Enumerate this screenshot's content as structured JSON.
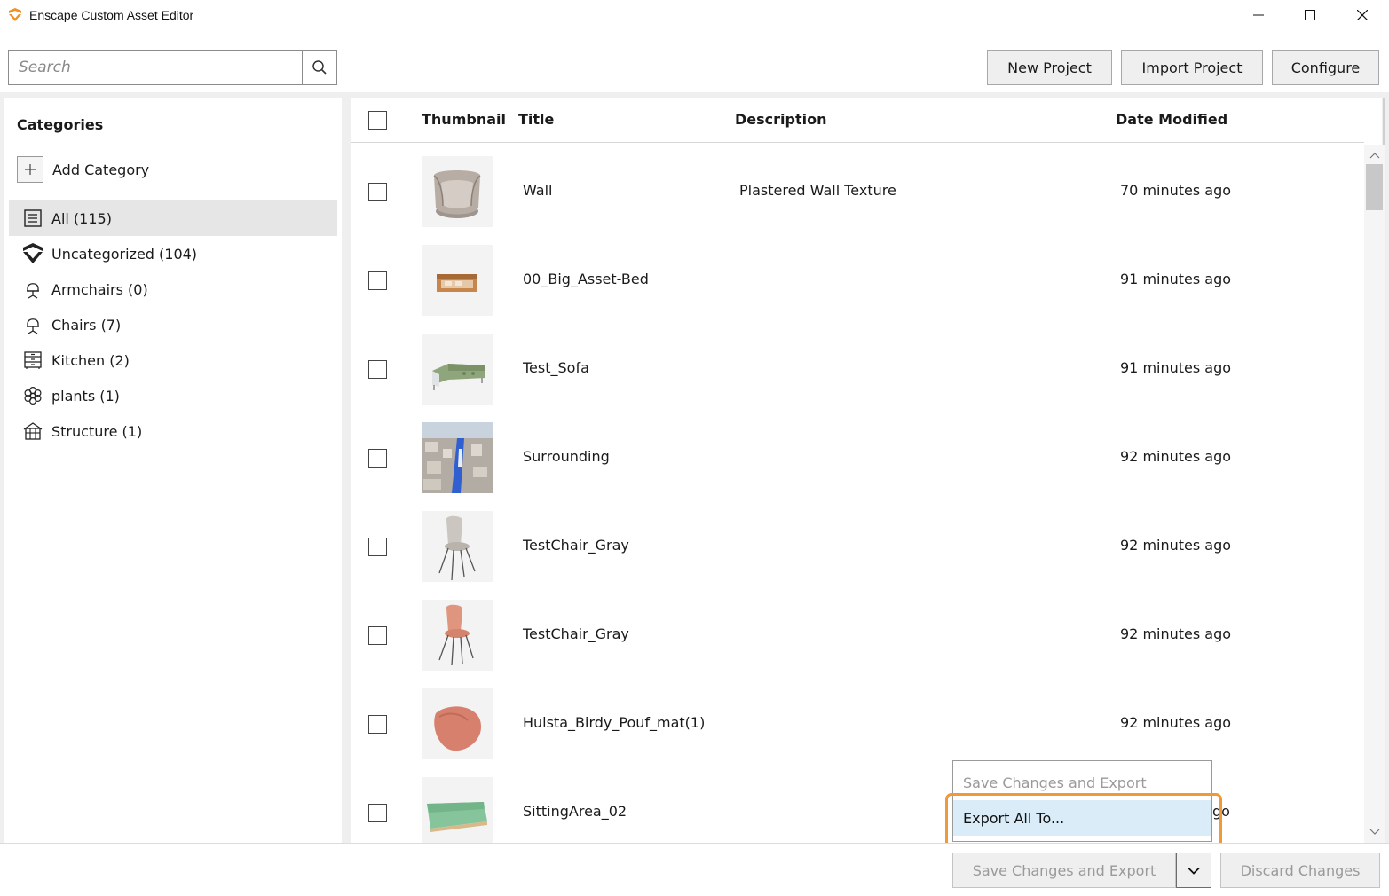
{
  "window": {
    "title": "Enscape Custom Asset Editor",
    "accent_color": "#f29222"
  },
  "search": {
    "placeholder": "Search"
  },
  "toolbar": {
    "new_project": "New Project",
    "import_project": "Import Project",
    "configure": "Configure"
  },
  "sidebar": {
    "heading": "Categories",
    "add_category": "Add Category",
    "items": [
      {
        "label": "All (115)",
        "icon": "list-icon",
        "selected": true
      },
      {
        "label": "Uncategorized (104)",
        "icon": "enscape-logo-icon",
        "selected": false
      },
      {
        "label": "Armchairs (0)",
        "icon": "armchair-icon",
        "selected": false
      },
      {
        "label": "Chairs (7)",
        "icon": "chair-icon",
        "selected": false
      },
      {
        "label": "Kitchen (2)",
        "icon": "kitchen-icon",
        "selected": false
      },
      {
        "label": "plants (1)",
        "icon": "plant-icon",
        "selected": false
      },
      {
        "label": "Structure (1)",
        "icon": "structure-icon",
        "selected": false
      }
    ]
  },
  "table": {
    "headers": {
      "thumbnail": "Thumbnail",
      "title": "Title",
      "description": "Description",
      "date_modified": "Date Modified"
    },
    "rows": [
      {
        "title": "Wall",
        "description": "Plastered Wall Texture",
        "date": "70 minutes ago",
        "thumb": "armchair"
      },
      {
        "title": "00_Big_Asset-Bed",
        "description": "",
        "date": "91 minutes ago",
        "thumb": "bed"
      },
      {
        "title": "Test_Sofa",
        "description": "",
        "date": "91 minutes ago",
        "thumb": "sofa"
      },
      {
        "title": "Surrounding",
        "description": "",
        "date": "92 minutes ago",
        "thumb": "city"
      },
      {
        "title": "TestChair_Gray",
        "description": "",
        "date": "92 minutes ago",
        "thumb": "chair-gray"
      },
      {
        "title": "TestChair_Gray",
        "description": "",
        "date": "92 minutes ago",
        "thumb": "chair-pink"
      },
      {
        "title": "Hulsta_Birdy_Pouf_mat(1)",
        "description": "",
        "date": "92 minutes ago",
        "thumb": "pouf"
      },
      {
        "title": "SittingArea_02",
        "description": "",
        "date": "",
        "thumb": "green-sofa"
      }
    ],
    "partial_date_fragment": "go"
  },
  "dropdown_menu": {
    "items": [
      {
        "label": "Save Changes and Export",
        "enabled": false
      },
      {
        "label": "Export All To...",
        "enabled": true,
        "hovered": true
      }
    ],
    "highlight_color": "#ef9a38"
  },
  "bottom": {
    "save_export": "Save Changes and Export",
    "discard": "Discard Changes"
  }
}
